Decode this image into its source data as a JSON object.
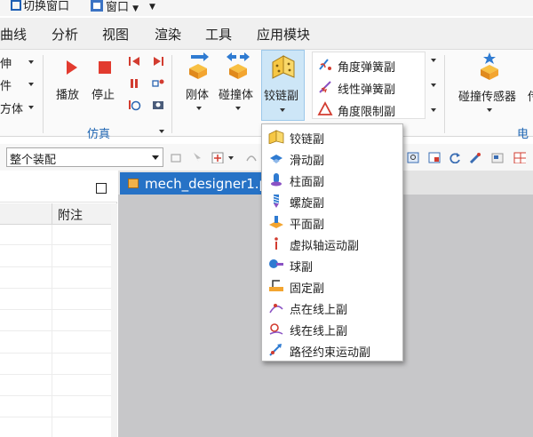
{
  "quick_access": {
    "switch_window": "切换窗口",
    "window": "窗口"
  },
  "menubar": [
    "曲线",
    "分析",
    "视图",
    "渲染",
    "工具",
    "应用模块"
  ],
  "ribbon": {
    "left_partial": [
      "伸",
      "件",
      "方体"
    ],
    "simulation": {
      "play": "播放",
      "stop": "停止",
      "group_label": "仿真"
    },
    "rigid_body": "刚体",
    "collision_body": "碰撞体",
    "joint": "铰链副",
    "constraints": [
      "角度弹簧副",
      "线性弹簧副",
      "角度限制副"
    ],
    "collision_sensor": "碰撞传感器",
    "right_partial": "传",
    "electrical_group_partial": "电"
  },
  "toolbar": {
    "assembly_select": "整个装配"
  },
  "navigator": {
    "column_header": "附注"
  },
  "viewport": {
    "tab_title": "mech_designer1.p"
  },
  "joint_menu": [
    {
      "label": "铰链副",
      "icon": "hinge-joint-icon"
    },
    {
      "label": "滑动副",
      "icon": "sliding-joint-icon"
    },
    {
      "label": "柱面副",
      "icon": "cylindrical-joint-icon"
    },
    {
      "label": "螺旋副",
      "icon": "screw-joint-icon"
    },
    {
      "label": "平面副",
      "icon": "planar-joint-icon"
    },
    {
      "label": "虚拟轴运动副",
      "icon": "virtual-axis-joint-icon"
    },
    {
      "label": "球副",
      "icon": "ball-joint-icon"
    },
    {
      "label": "固定副",
      "icon": "fixed-joint-icon"
    },
    {
      "label": "点在线上副",
      "icon": "point-on-curve-joint-icon"
    },
    {
      "label": "线在线上副",
      "icon": "curve-on-curve-joint-icon"
    },
    {
      "label": "路径约束运动副",
      "icon": "path-constraint-joint-icon"
    }
  ],
  "colors": {
    "accent_blue": "#2672c6",
    "group_label_blue": "#1f66b3",
    "play_red": "#e23b2f",
    "joint_selected_bg": "#cde6f7"
  }
}
